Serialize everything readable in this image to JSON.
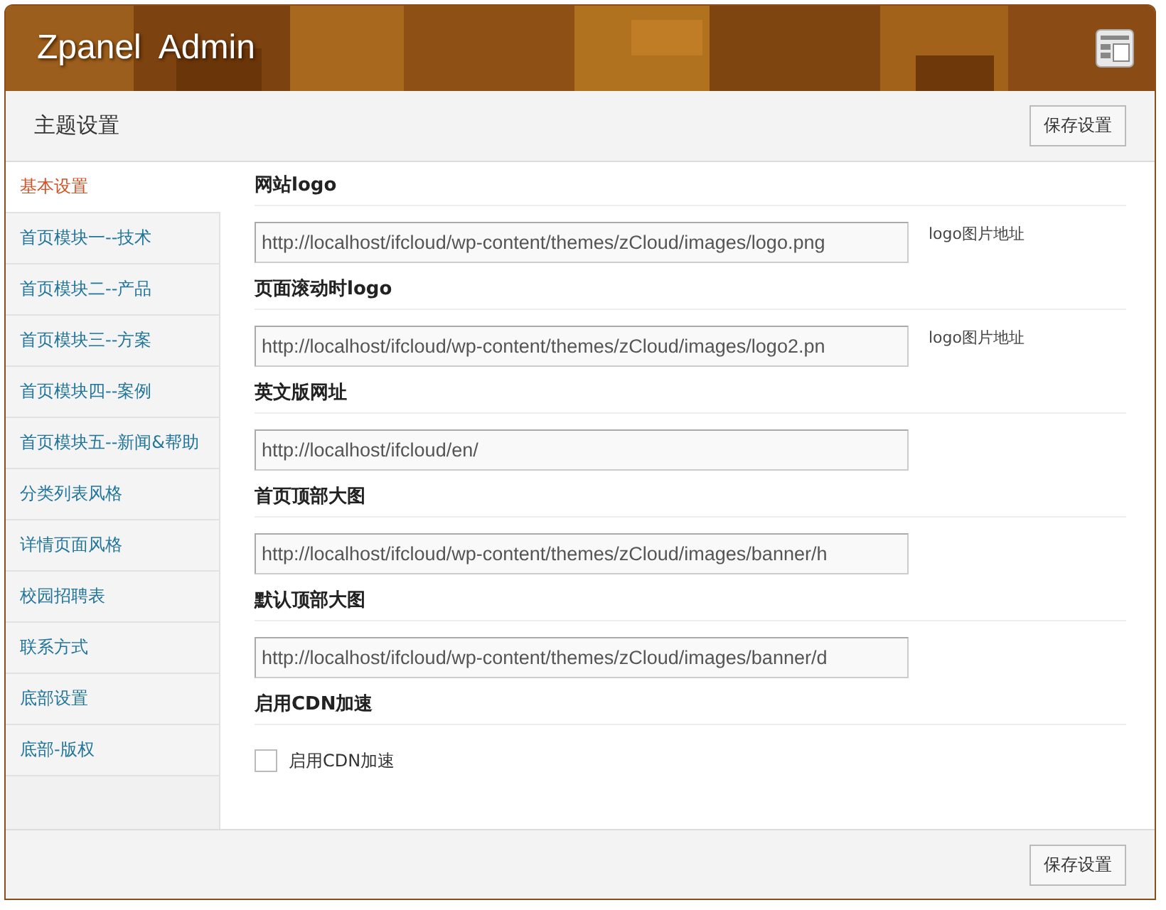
{
  "header": {
    "title": "Zpanel  Admin"
  },
  "toolbar": {
    "title": "主题设置",
    "save_button": "保存设置"
  },
  "sidebar": {
    "items": [
      {
        "label": "基本设置",
        "selected": true
      },
      {
        "label": "首页模块一--技术",
        "selected": false
      },
      {
        "label": "首页模块二--产品",
        "selected": false
      },
      {
        "label": "首页模块三--方案",
        "selected": false
      },
      {
        "label": "首页模块四--案例",
        "selected": false
      },
      {
        "label": "首页模块五--新闻&帮助",
        "selected": false
      },
      {
        "label": "分类列表风格",
        "selected": false
      },
      {
        "label": "详情页面风格",
        "selected": false
      },
      {
        "label": "校园招聘表",
        "selected": false
      },
      {
        "label": "联系方式",
        "selected": false
      },
      {
        "label": "底部设置",
        "selected": false
      },
      {
        "label": "底部-版权",
        "selected": false
      }
    ]
  },
  "sections": [
    {
      "kind": "text",
      "heading": "网站logo",
      "value": "http://localhost/ifcloud/wp-content/themes/zCloud/images/logo.png",
      "hint": "logo图片地址"
    },
    {
      "kind": "text",
      "heading": "页面滚动时logo",
      "value": "http://localhost/ifcloud/wp-content/themes/zCloud/images/logo2.pn",
      "hint": "logo图片地址"
    },
    {
      "kind": "text",
      "heading": "英文版网址",
      "value": "http://localhost/ifcloud/en/"
    },
    {
      "kind": "text",
      "heading": "首页顶部大图",
      "value": "http://localhost/ifcloud/wp-content/themes/zCloud/images/banner/h"
    },
    {
      "kind": "text",
      "heading": "默认顶部大图",
      "value": "http://localhost/ifcloud/wp-content/themes/zCloud/images/banner/d"
    },
    {
      "kind": "checkbox",
      "heading": "启用CDN加速",
      "label": "启用CDN加速",
      "checked": false
    }
  ],
  "footer": {
    "save_button": "保存设置"
  }
}
